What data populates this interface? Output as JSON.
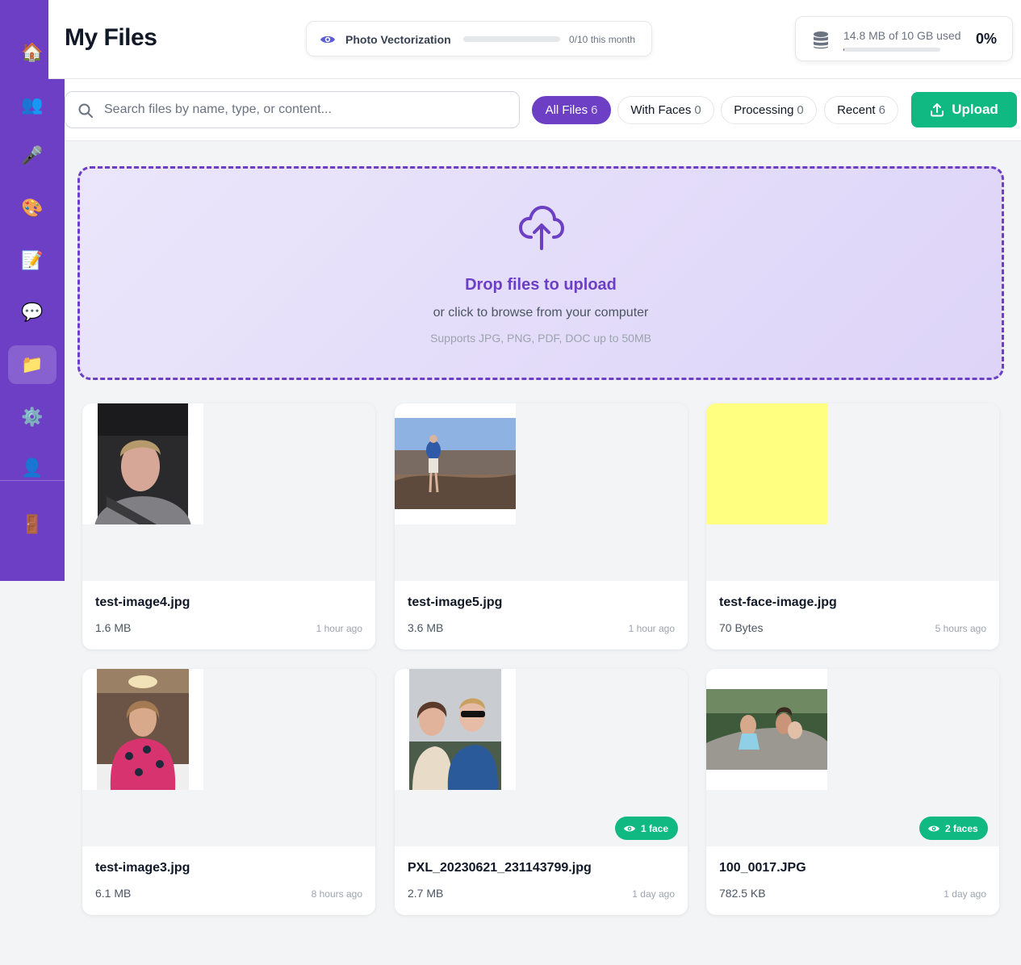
{
  "sidebar": {
    "items": [
      {
        "icon": "home-icon",
        "glyph": "🏠"
      },
      {
        "icon": "users-icon",
        "glyph": "👥"
      },
      {
        "icon": "microphone-icon",
        "glyph": "🎤"
      },
      {
        "icon": "palette-icon",
        "glyph": "🎨"
      },
      {
        "icon": "memo-icon",
        "glyph": "📝"
      },
      {
        "icon": "chat-bubble-icon",
        "glyph": "💬"
      },
      {
        "icon": "folder-icon",
        "glyph": "📁",
        "active": true
      },
      {
        "icon": "gear-icon",
        "glyph": "⚙️"
      },
      {
        "icon": "user-icon",
        "glyph": "👤"
      },
      {
        "icon": "door-icon",
        "glyph": "🚪"
      }
    ]
  },
  "header": {
    "title": "My Files",
    "quota": {
      "label": "Photo Vectorization",
      "count": "0/10 this month",
      "progress": 0
    },
    "storage": {
      "text": "14.8 MB of 10 GB used",
      "percent": "0%",
      "progress": 0.0015
    }
  },
  "toolbar": {
    "search_placeholder": "Search files by name, type, or content...",
    "filters": [
      {
        "label": "All Files",
        "count": "6",
        "active": true
      },
      {
        "label": "With Faces",
        "count": "0"
      },
      {
        "label": "Processing",
        "count": "0"
      },
      {
        "label": "Recent",
        "count": "6"
      }
    ],
    "upload_label": "Upload"
  },
  "dropzone": {
    "title": "Drop files to upload",
    "subtitle": "or click to browse from your computer",
    "hint": "Supports JPG, PNG, PDF, DOC up to 50MB"
  },
  "files": [
    {
      "name": "test-image4.jpg",
      "size": "1.6 MB",
      "time": "1 hour ago",
      "badge": ""
    },
    {
      "name": "test-image5.jpg",
      "size": "3.6 MB",
      "time": "1 hour ago",
      "badge": ""
    },
    {
      "name": "test-face-image.jpg",
      "size": "70 Bytes",
      "time": "5 hours ago",
      "badge": ""
    },
    {
      "name": "test-image3.jpg",
      "size": "6.1 MB",
      "time": "8 hours ago",
      "badge": ""
    },
    {
      "name": "PXL_20230621_231143799.jpg",
      "size": "2.7 MB",
      "time": "1 day ago",
      "badge": "1 face"
    },
    {
      "name": "100_0017.JPG",
      "size": "782.5 KB",
      "time": "1 day ago",
      "badge": "2 faces"
    }
  ],
  "colors": {
    "accent": "#6c3fc5",
    "success": "#10b981",
    "background": "#f3f4f6"
  }
}
